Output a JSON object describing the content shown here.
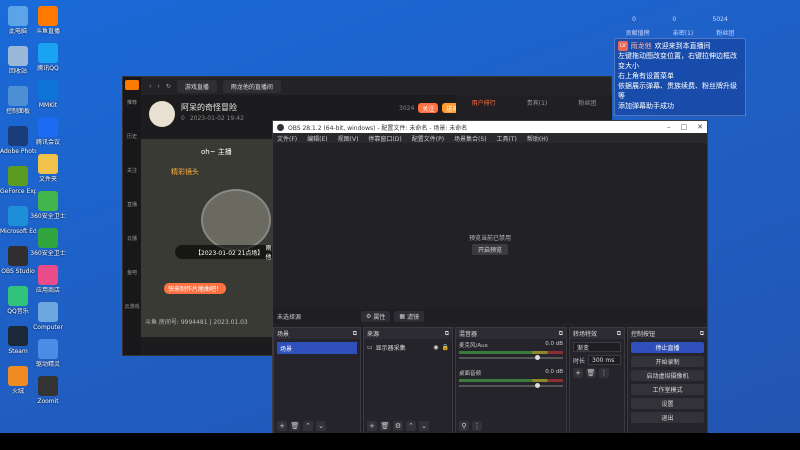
{
  "desktop": {
    "icons_left": [
      {
        "label": "此电脑",
        "icon": "computer-icon",
        "color": "#5da3e8"
      },
      {
        "label": "回收站",
        "icon": "recycle-bin-icon",
        "color": "#9ab8d8"
      },
      {
        "label": "控制面板",
        "icon": "control-panel-icon",
        "color": "#4c8fd4"
      },
      {
        "label": "Adobe Photoshop",
        "icon": "photoshop-icon",
        "color": "#1a3d7a"
      },
      {
        "label": "GeForce Experience",
        "icon": "geforce-icon",
        "color": "#5b9b21"
      },
      {
        "label": "Microsoft Edge",
        "icon": "edge-icon",
        "color": "#1f8ed8"
      },
      {
        "label": "OBS Studio",
        "icon": "obs-icon",
        "color": "#302e31"
      },
      {
        "label": "QQ音乐",
        "icon": "qqmusic-icon",
        "color": "#31c27c"
      },
      {
        "label": "Steam",
        "icon": "steam-icon",
        "color": "#1b2838"
      },
      {
        "label": "火绒",
        "icon": "huorong-icon",
        "color": "#f08b24"
      }
    ],
    "icons_right": [
      {
        "label": "斗鱼直播",
        "icon": "douyu-icon",
        "color": "#ff7a00"
      },
      {
        "label": "腾讯QQ",
        "icon": "qq-icon",
        "color": "#1aa3f0"
      },
      {
        "label": "MMKit",
        "icon": "mmkit-icon",
        "color": "#0d74d8"
      },
      {
        "label": "腾讯会议",
        "icon": "tencent-meeting-icon",
        "color": "#1b6cf2"
      },
      {
        "label": "文件夹",
        "icon": "folder-icon",
        "color": "#f0c24a"
      },
      {
        "label": "360安全卫士",
        "icon": "360-icon",
        "color": "#3fb54a"
      },
      {
        "label": "360安全卫士",
        "icon": "360-plus-icon",
        "color": "#31a53f"
      },
      {
        "label": "应用商店",
        "icon": "store-icon",
        "color": "#ea4c89"
      },
      {
        "label": "Computer",
        "icon": "computer2-icon",
        "color": "#6ea6e0"
      },
      {
        "label": "驱动精灵",
        "icon": "driver-icon",
        "color": "#4b8ce6"
      },
      {
        "label": "Zoomit",
        "icon": "zoomit-icon",
        "color": "#333333"
      }
    ]
  },
  "chat_overlay": {
    "stats": [
      "0",
      "0",
      "5024"
    ],
    "tabs": [
      "贡献值榜",
      "亲密(1)",
      "粉丝团"
    ],
    "welcome_user": "雨龙他",
    "welcome_text": "欢迎来到本直播间",
    "lines": [
      "左键拖动图改变位置，右键拉伸边框改变大小",
      "右上角有设置菜单",
      "依据展示弹幕、贵族续费、粉丝牌升级等",
      "添加弹幕助手成功"
    ]
  },
  "douyu": {
    "nav_items": [
      "推荐",
      "历史",
      "关注",
      "直播",
      "云播",
      "鱼吧",
      "云游戏"
    ],
    "search_tab": "游戏直播",
    "room_tab": "雨龙他的直播间",
    "streamer_name": "阿呆的奇怪冒险",
    "streamer_meta": [
      "0",
      "2023-01-02 19:42"
    ],
    "follow_count": "3024",
    "btn_follow": "关注",
    "btn_gift": "送礼物",
    "right_tabs": [
      "用户排行",
      "贵宾(1)",
      "粉丝团"
    ],
    "footer_text": "斗鱼 房间号: 9994481 | 2023.01.03",
    "promo": "快来制作片尾曲吧！",
    "video_caption": "oh~ 主播",
    "video_user": "精彩镜头",
    "video_msg": "【2023-01-02 21点场】",
    "video_msg2": "雨龙他"
  },
  "obs": {
    "title": "OBS 28.1.2 (64-bit, windows) - 配置文件: 未命名 - 场景: 未命名",
    "menu": [
      "文件(F)",
      "编辑(E)",
      "视图(V)",
      "停靠窗口(D)",
      "配置文件(P)",
      "场景集合(S)",
      "工具(T)",
      "帮助(H)"
    ],
    "preview_disabled_text": "预览当前已禁用",
    "start_preview_label": "开启预览",
    "no_source_selected": "未选择源",
    "properties_label": "属性",
    "filters_label": "滤镜",
    "scenes": {
      "title": "场景",
      "items": [
        "场景"
      ]
    },
    "sources": {
      "title": "来源",
      "items": [
        "显示器采集"
      ]
    },
    "mixer": {
      "title": "混音器",
      "channels": [
        {
          "name": "麦克风/Aux",
          "db": "0.0 dB"
        },
        {
          "name": "桌面音频",
          "db": "0.0 dB"
        }
      ]
    },
    "transitions": {
      "title": "转场特效",
      "current": "渐变",
      "duration_label": "时长",
      "duration_value": "300 ms"
    },
    "controls": {
      "title": "控制按钮",
      "buttons": [
        "停止直播",
        "开始录制",
        "启动虚拟摄像机",
        "工作室模式",
        "设置",
        "退出"
      ]
    }
  }
}
